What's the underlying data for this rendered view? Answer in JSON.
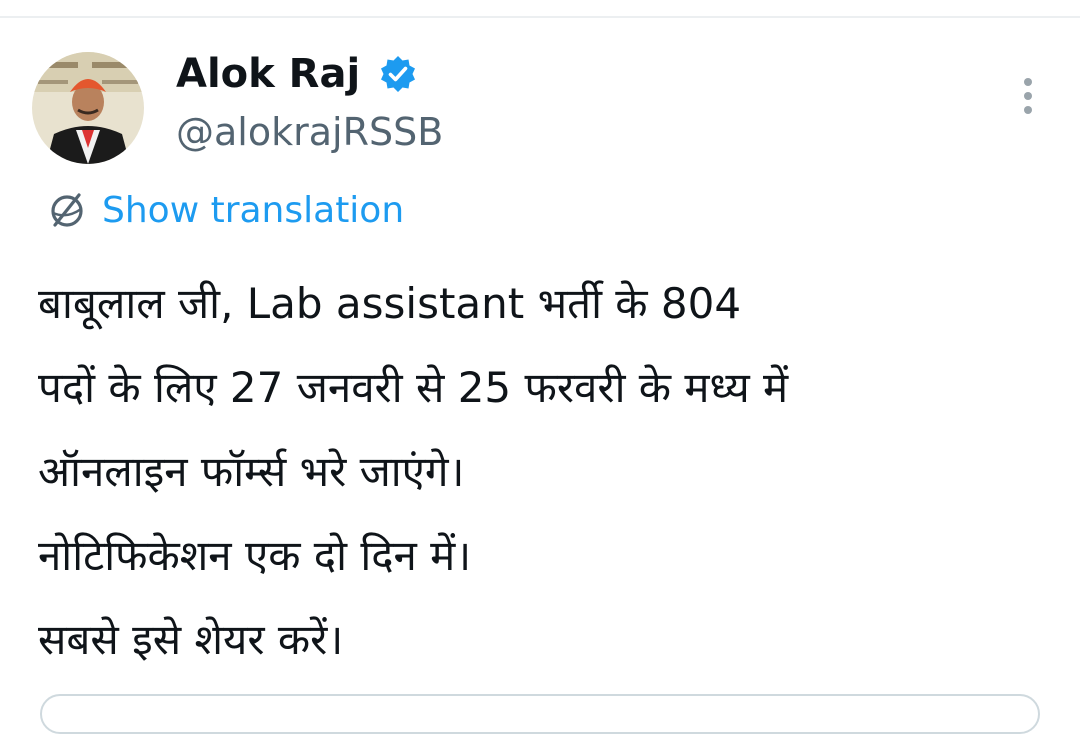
{
  "tweet": {
    "author": {
      "display_name": "Alok Raj",
      "handle": "@alokrajRSSB",
      "verified": true,
      "avatar": "profile-photo"
    },
    "translation_link": "Show translation",
    "text_lines": [
      "बाबूलाल जी, Lab assistant भर्ती के 804",
      "पदों के लिए 27 जनवरी से 25 फरवरी के मध्य में",
      "ऑनलाइन फॉर्म्स भरे जाएंगे।",
      "नोटिफिकेशन एक दो दिन में।",
      "सबसे इसे शेयर करें।"
    ]
  },
  "icons": {
    "verified": "verified-badge-icon",
    "more": "more-vertical-icon",
    "translate": "translate-globe-icon"
  },
  "colors": {
    "accent": "#1d9bf0",
    "text_primary": "#0f1419",
    "text_secondary": "#536471"
  }
}
